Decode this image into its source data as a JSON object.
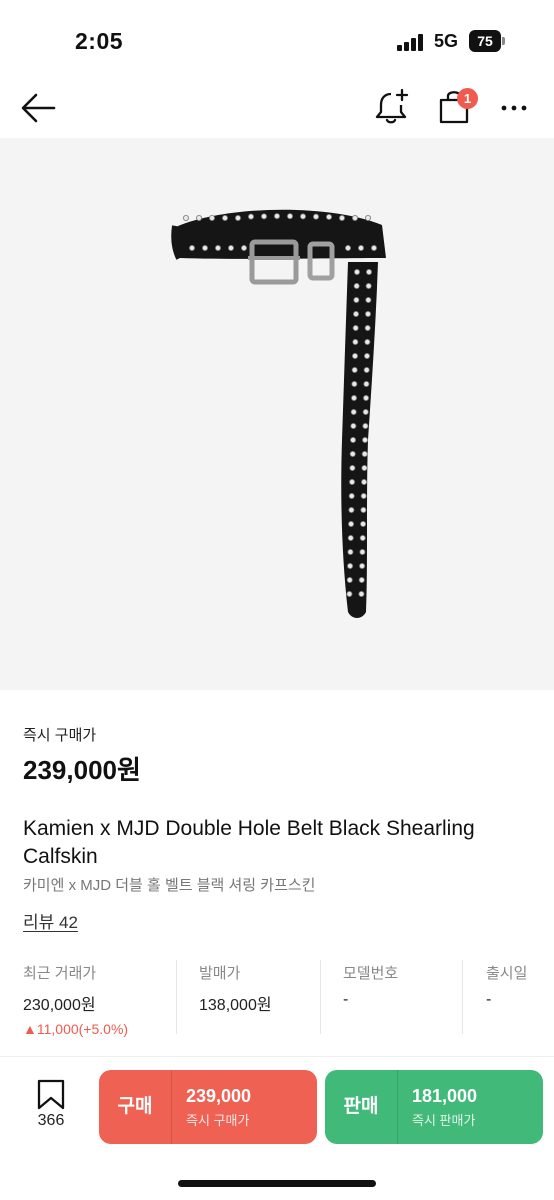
{
  "status_bar": {
    "time": "2:05",
    "network": "5G",
    "battery": "75"
  },
  "nav": {
    "cart_count": "1"
  },
  "product": {
    "price_label": "즉시 구매가",
    "price": "239,000원",
    "title_en": "Kamien x MJD Double Hole Belt Black Shearling Calfskin",
    "title_ko": "카미엔 x MJD 더블 홀 벨트 블랙 셔링 카프스킨",
    "review": "리뷰 42"
  },
  "stats": [
    {
      "title": "최근 거래가",
      "value": "230,000원",
      "change": "▲11,000(+5.0%)"
    },
    {
      "title": "발매가",
      "value": "138,000원"
    },
    {
      "title": "모델번호",
      "value": "-"
    },
    {
      "title": "출시일",
      "value": "-"
    }
  ],
  "bottom": {
    "wish_count": "366",
    "buy": {
      "label": "구매",
      "price": "239,000",
      "sub": "즉시 구매가"
    },
    "sell": {
      "label": "판매",
      "price": "181,000",
      "sub": "즉시 판매가"
    }
  },
  "colors": {
    "buy": "#ef6253",
    "sell": "#41b979",
    "up": "#ef5b4f",
    "badge": "#ef5b4f"
  },
  "icons": [
    "back-arrow-icon",
    "bell-plus-icon",
    "shopping-bag-icon",
    "more-icon",
    "bookmark-icon",
    "signal-icon",
    "battery-icon"
  ]
}
